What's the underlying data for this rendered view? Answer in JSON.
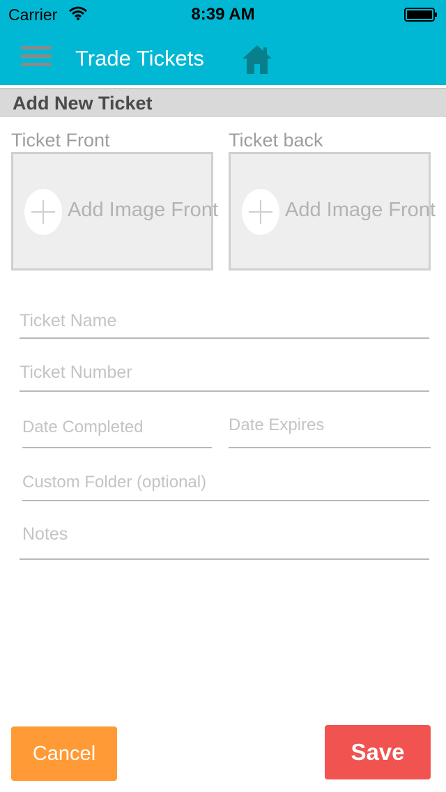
{
  "status_bar": {
    "carrier": "Carrier",
    "time": "8:39 AM"
  },
  "nav": {
    "title": "Trade Tickets",
    "menu_icon": "hamburger-menu-icon",
    "home_icon": "home-icon",
    "bar_color": "#00b8d4"
  },
  "section": {
    "title": "Add New Ticket"
  },
  "images": {
    "front_label": "Ticket Front",
    "back_label": "Ticket back",
    "front_button": "Add Image Front",
    "back_button": "Add Image Front"
  },
  "form": {
    "ticket_name_placeholder": "Ticket Name",
    "ticket_number_placeholder": "Ticket Number",
    "date_completed_placeholder": "Date Completed",
    "date_expires_placeholder": "Date Expires",
    "custom_folder_placeholder": "Custom Folder (optional)",
    "notes_placeholder": "Notes"
  },
  "actions": {
    "cancel_label": "Cancel",
    "save_label": "Save",
    "cancel_color": "#ff9a36",
    "save_color": "#f05350"
  }
}
